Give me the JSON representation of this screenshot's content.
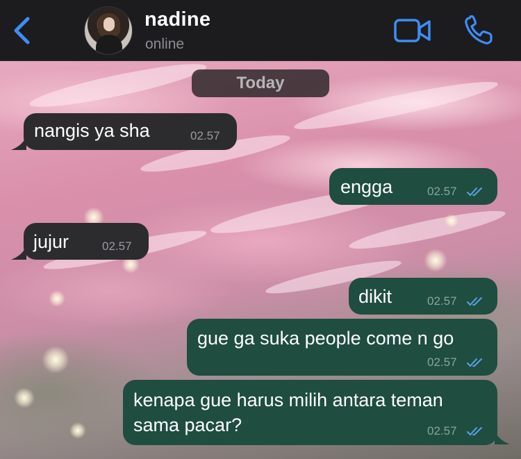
{
  "header": {
    "contact_name": "nadine",
    "status": "online",
    "icons": {
      "back": "chevron-left-icon",
      "video": "video-camera-icon",
      "call": "phone-icon"
    },
    "accent_color": "#3d8ef7"
  },
  "chat": {
    "date_label": "Today",
    "messages": [
      {
        "direction": "incoming",
        "text": "nangis ya sha",
        "time": "02.57"
      },
      {
        "direction": "outgoing",
        "text": "engga",
        "time": "02.57",
        "read": true
      },
      {
        "direction": "incoming",
        "text": "jujur",
        "time": "02.57"
      },
      {
        "direction": "outgoing",
        "text": "dikit",
        "time": "02.57",
        "read": true
      },
      {
        "direction": "outgoing",
        "text": "gue ga suka people come n go",
        "time": "02.57",
        "read": true
      },
      {
        "direction": "outgoing",
        "lines": [
          "kenapa gue harus milih antara teman",
          "sama pacar?"
        ],
        "time": "02.57",
        "read": true
      }
    ],
    "colors": {
      "incoming_bubble": "#2c2c2e",
      "outgoing_bubble": "#1f4d40",
      "read_ticks": "#5aa0e6"
    }
  }
}
